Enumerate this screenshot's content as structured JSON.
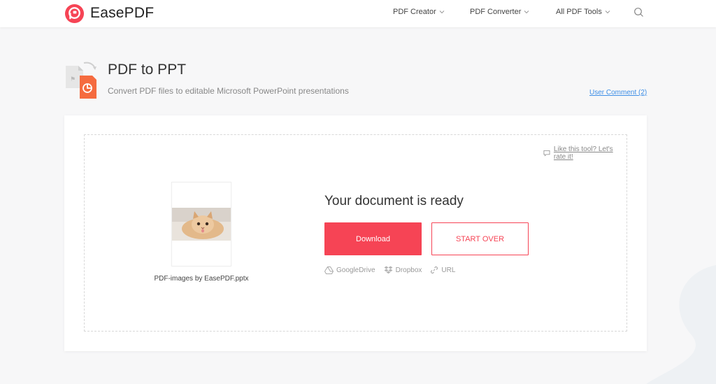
{
  "header": {
    "logo_text": "EasePDF",
    "nav": [
      {
        "label": "PDF Creator"
      },
      {
        "label": "PDF Converter"
      },
      {
        "label": "All PDF Tools"
      }
    ],
    "search_icon": "search-icon"
  },
  "tool": {
    "title": "PDF to PPT",
    "subtitle": "Convert PDF files to editable Microsoft PowerPoint presentations",
    "user_comment": "User Comment (2)"
  },
  "result": {
    "rate_link": "Like this tool? Let's rate it!",
    "ready_text": "Your document is ready",
    "download_label": "Download",
    "start_over_label": "START OVER",
    "file_name": "PDF-images by EasePDF.pptx",
    "share": [
      {
        "label": "GoogleDrive",
        "icon": "google-drive-icon"
      },
      {
        "label": "Dropbox",
        "icon": "dropbox-icon"
      },
      {
        "label": "URL",
        "icon": "link-icon"
      }
    ]
  },
  "colors": {
    "accent": "#f64455",
    "link": "#3d8ee6",
    "background": "#f7f7f8"
  }
}
